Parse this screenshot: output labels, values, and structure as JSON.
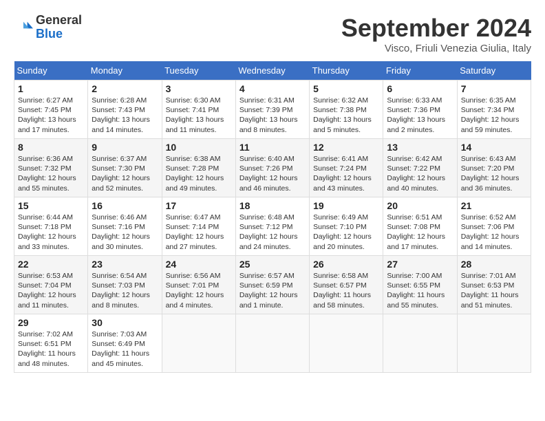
{
  "header": {
    "logo_general": "General",
    "logo_blue": "Blue",
    "title": "September 2024",
    "location": "Visco, Friuli Venezia Giulia, Italy"
  },
  "columns": [
    "Sunday",
    "Monday",
    "Tuesday",
    "Wednesday",
    "Thursday",
    "Friday",
    "Saturday"
  ],
  "weeks": [
    [
      {
        "day": 1,
        "info": "Sunrise: 6:27 AM\nSunset: 7:45 PM\nDaylight: 13 hours and 17 minutes."
      },
      {
        "day": 2,
        "info": "Sunrise: 6:28 AM\nSunset: 7:43 PM\nDaylight: 13 hours and 14 minutes."
      },
      {
        "day": 3,
        "info": "Sunrise: 6:30 AM\nSunset: 7:41 PM\nDaylight: 13 hours and 11 minutes."
      },
      {
        "day": 4,
        "info": "Sunrise: 6:31 AM\nSunset: 7:39 PM\nDaylight: 13 hours and 8 minutes."
      },
      {
        "day": 5,
        "info": "Sunrise: 6:32 AM\nSunset: 7:38 PM\nDaylight: 13 hours and 5 minutes."
      },
      {
        "day": 6,
        "info": "Sunrise: 6:33 AM\nSunset: 7:36 PM\nDaylight: 13 hours and 2 minutes."
      },
      {
        "day": 7,
        "info": "Sunrise: 6:35 AM\nSunset: 7:34 PM\nDaylight: 12 hours and 59 minutes."
      }
    ],
    [
      {
        "day": 8,
        "info": "Sunrise: 6:36 AM\nSunset: 7:32 PM\nDaylight: 12 hours and 55 minutes."
      },
      {
        "day": 9,
        "info": "Sunrise: 6:37 AM\nSunset: 7:30 PM\nDaylight: 12 hours and 52 minutes."
      },
      {
        "day": 10,
        "info": "Sunrise: 6:38 AM\nSunset: 7:28 PM\nDaylight: 12 hours and 49 minutes."
      },
      {
        "day": 11,
        "info": "Sunrise: 6:40 AM\nSunset: 7:26 PM\nDaylight: 12 hours and 46 minutes."
      },
      {
        "day": 12,
        "info": "Sunrise: 6:41 AM\nSunset: 7:24 PM\nDaylight: 12 hours and 43 minutes."
      },
      {
        "day": 13,
        "info": "Sunrise: 6:42 AM\nSunset: 7:22 PM\nDaylight: 12 hours and 40 minutes."
      },
      {
        "day": 14,
        "info": "Sunrise: 6:43 AM\nSunset: 7:20 PM\nDaylight: 12 hours and 36 minutes."
      }
    ],
    [
      {
        "day": 15,
        "info": "Sunrise: 6:44 AM\nSunset: 7:18 PM\nDaylight: 12 hours and 33 minutes."
      },
      {
        "day": 16,
        "info": "Sunrise: 6:46 AM\nSunset: 7:16 PM\nDaylight: 12 hours and 30 minutes."
      },
      {
        "day": 17,
        "info": "Sunrise: 6:47 AM\nSunset: 7:14 PM\nDaylight: 12 hours and 27 minutes."
      },
      {
        "day": 18,
        "info": "Sunrise: 6:48 AM\nSunset: 7:12 PM\nDaylight: 12 hours and 24 minutes."
      },
      {
        "day": 19,
        "info": "Sunrise: 6:49 AM\nSunset: 7:10 PM\nDaylight: 12 hours and 20 minutes."
      },
      {
        "day": 20,
        "info": "Sunrise: 6:51 AM\nSunset: 7:08 PM\nDaylight: 12 hours and 17 minutes."
      },
      {
        "day": 21,
        "info": "Sunrise: 6:52 AM\nSunset: 7:06 PM\nDaylight: 12 hours and 14 minutes."
      }
    ],
    [
      {
        "day": 22,
        "info": "Sunrise: 6:53 AM\nSunset: 7:04 PM\nDaylight: 12 hours and 11 minutes."
      },
      {
        "day": 23,
        "info": "Sunrise: 6:54 AM\nSunset: 7:03 PM\nDaylight: 12 hours and 8 minutes."
      },
      {
        "day": 24,
        "info": "Sunrise: 6:56 AM\nSunset: 7:01 PM\nDaylight: 12 hours and 4 minutes."
      },
      {
        "day": 25,
        "info": "Sunrise: 6:57 AM\nSunset: 6:59 PM\nDaylight: 12 hours and 1 minute."
      },
      {
        "day": 26,
        "info": "Sunrise: 6:58 AM\nSunset: 6:57 PM\nDaylight: 11 hours and 58 minutes."
      },
      {
        "day": 27,
        "info": "Sunrise: 7:00 AM\nSunset: 6:55 PM\nDaylight: 11 hours and 55 minutes."
      },
      {
        "day": 28,
        "info": "Sunrise: 7:01 AM\nSunset: 6:53 PM\nDaylight: 11 hours and 51 minutes."
      }
    ],
    [
      {
        "day": 29,
        "info": "Sunrise: 7:02 AM\nSunset: 6:51 PM\nDaylight: 11 hours and 48 minutes."
      },
      {
        "day": 30,
        "info": "Sunrise: 7:03 AM\nSunset: 6:49 PM\nDaylight: 11 hours and 45 minutes."
      },
      null,
      null,
      null,
      null,
      null
    ]
  ]
}
